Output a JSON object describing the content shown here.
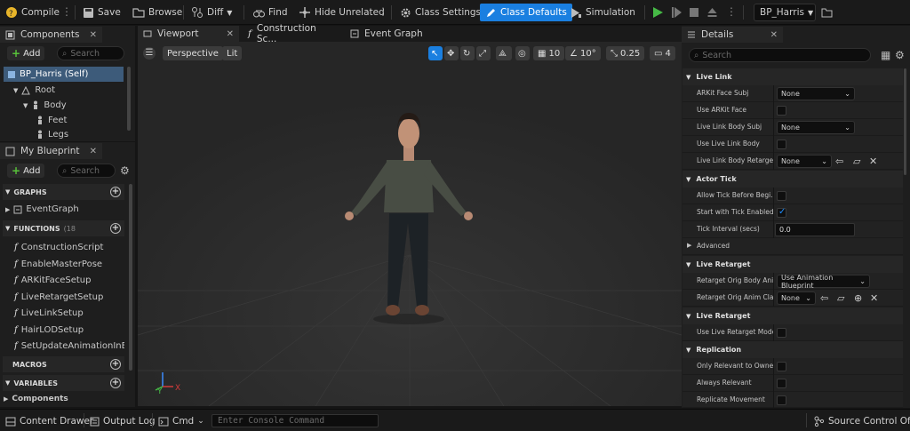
{
  "toolbar": {
    "compile": "Compile",
    "save": "Save",
    "browse": "Browse",
    "diff": "Diff",
    "find": "Find",
    "hide_unrelated": "Hide Unrelated",
    "class_settings": "Class Settings",
    "class_defaults": "Class Defaults",
    "simulation": "Simulation",
    "debug_object": "BP_Harris"
  },
  "components": {
    "tab": "Components",
    "add": "Add",
    "search_placeholder": "Search",
    "items": [
      "BP_Harris (Self)",
      "Root",
      "Body",
      "Feet",
      "Legs"
    ]
  },
  "my_blueprint": {
    "tab": "My Blueprint",
    "add": "Add",
    "search_placeholder": "Search",
    "graphs_header": "GRAPHS",
    "graph_item": "EventGraph",
    "functions_header": "FUNCTIONS",
    "functions_count": "(18",
    "functions": [
      "ConstructionScript",
      "EnableMasterPose",
      "ARKitFaceSetup",
      "LiveRetargetSetup",
      "LiveLinkSetup",
      "HairLODSetup",
      "SetUpdateAnimationInEdi"
    ],
    "macros_header": "MACROS",
    "variables_header": "VARIABLES",
    "components_sub": "Components"
  },
  "editor_tabs": {
    "viewport": "Viewport",
    "construction": "Construction Sc...",
    "event_graph": "Event Graph"
  },
  "viewport": {
    "perspective": "Perspective",
    "lit": "Lit",
    "grid_snap": "10",
    "rot_snap": "10°",
    "scale_snap": "0.25",
    "camera_speed": "4",
    "axis_y": "Y",
    "axis_x": "X",
    "axis_z": "Z"
  },
  "details": {
    "tab": "Details",
    "search_placeholder": "Search",
    "live_link_header": "Live Link",
    "arkit_face_subj": "ARKit Face Subj",
    "arkit_face_subj_val": "None",
    "use_arkit_face": "Use ARKit Face",
    "live_link_body_subj": "Live Link Body Subj",
    "live_link_body_subj_val": "None",
    "use_live_link_body": "Use Live Link Body",
    "live_link_body_retarget": "Live Link Body Retarget",
    "live_link_body_retarget_val": "None",
    "actor_tick_header": "Actor Tick",
    "allow_tick": "Allow Tick Before Begi...",
    "start_tick": "Start with Tick Enabled",
    "tick_interval": "Tick Interval (secs)",
    "tick_interval_val": "0.0",
    "advanced": "Advanced",
    "live_retarget_header": "Live Retarget",
    "retarget_body": "Retarget Orig Body Ani...",
    "retarget_body_val": "Use Animation Blueprint",
    "retarget_anim": "Retarget Orig Anim Cla...",
    "retarget_anim_val": "None",
    "live_retarget_header2": "Live Retarget",
    "use_live_retarget": "Use Live Retarget Mode",
    "replication_header": "Replication",
    "only_relevant": "Only Relevant to Owner",
    "always_relevant": "Always Relevant",
    "replicate_movement": "Replicate Movement"
  },
  "status": {
    "content_drawer": "Content Drawer",
    "output_log": "Output Log",
    "cmd": "Cmd",
    "console_placeholder": "Enter Console Command",
    "source_control": "Source Control Off"
  },
  "colors": {
    "accent": "#1a7fe0",
    "play_green": "#46b946",
    "selection": "#3d5b7a"
  }
}
